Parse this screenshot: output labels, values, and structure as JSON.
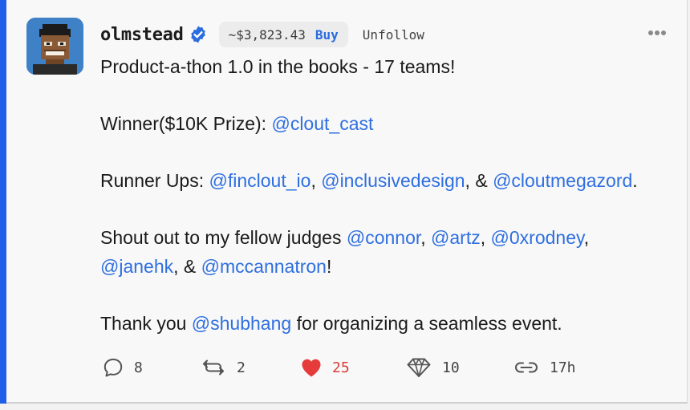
{
  "post": {
    "author": {
      "username": "olmstead",
      "verified": true,
      "coin_price": "~$3,823.43",
      "buy_label": "Buy",
      "follow_label": "Unfollow"
    },
    "more_icon": "ellipsis-icon",
    "body": {
      "line1": "Product-a-thon 1.0 in the books - 17 teams!",
      "winner_prefix": "Winner($10K Prize): ",
      "winner_mention": "@clout_cast",
      "runner_prefix": "Runner Ups: ",
      "runner_mention_1": "@finclout_io",
      "runner_sep_1": ", ",
      "runner_mention_2": "@inclusivedesign",
      "runner_sep_2": ", & ",
      "runner_mention_3": "@cloutmegazord",
      "runner_end": ".",
      "judges_prefix": "Shout out to my fellow judges ",
      "judge_1": "@connor",
      "judge_sep_1": ", ",
      "judge_2": "@artz",
      "judge_sep_2": ", ",
      "judge_3": "@0xrodney",
      "judge_sep_3": ",",
      "judge_4": "@janehk",
      "judge_sep_4": ", & ",
      "judge_5": "@mccannatron",
      "judges_end": "!",
      "thanks_prefix": "Thank you ",
      "thanks_mention": "@shubhang",
      "thanks_suffix": " for organizing a seamless event."
    },
    "stats": {
      "comments": "8",
      "reclouts": "2",
      "likes": "25",
      "diamonds": "10",
      "time": "17h"
    },
    "colors": {
      "accent_bar": "#1f5ee6",
      "mention": "#2f6fe0",
      "like": "#d83b3b",
      "verified": "#2a6cdf"
    }
  }
}
